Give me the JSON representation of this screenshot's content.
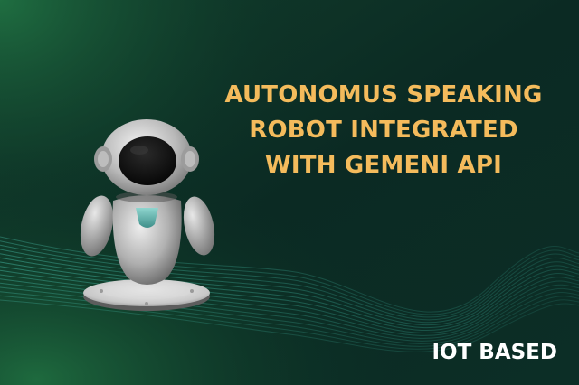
{
  "headline": {
    "lines": [
      "AUTONOMUS SPEAKING",
      "ROBOT INTEGRATED",
      "WITH GEMENI API"
    ]
  },
  "footer_tag": "IOT BASED",
  "colors": {
    "background_dark": "#0a2a22",
    "background_green": "#1b6a3c",
    "headline": "#f4bb5c",
    "footer_tag": "#ffffff",
    "wave_lines": "#2f8a7a",
    "robot_body": "#c9c9c9",
    "robot_visor": "#0c0c0c",
    "robot_chest": "#5fb3ad"
  },
  "icons": {
    "robot": "robot-figure-illustration",
    "waves": "flowing-wave-lines"
  }
}
